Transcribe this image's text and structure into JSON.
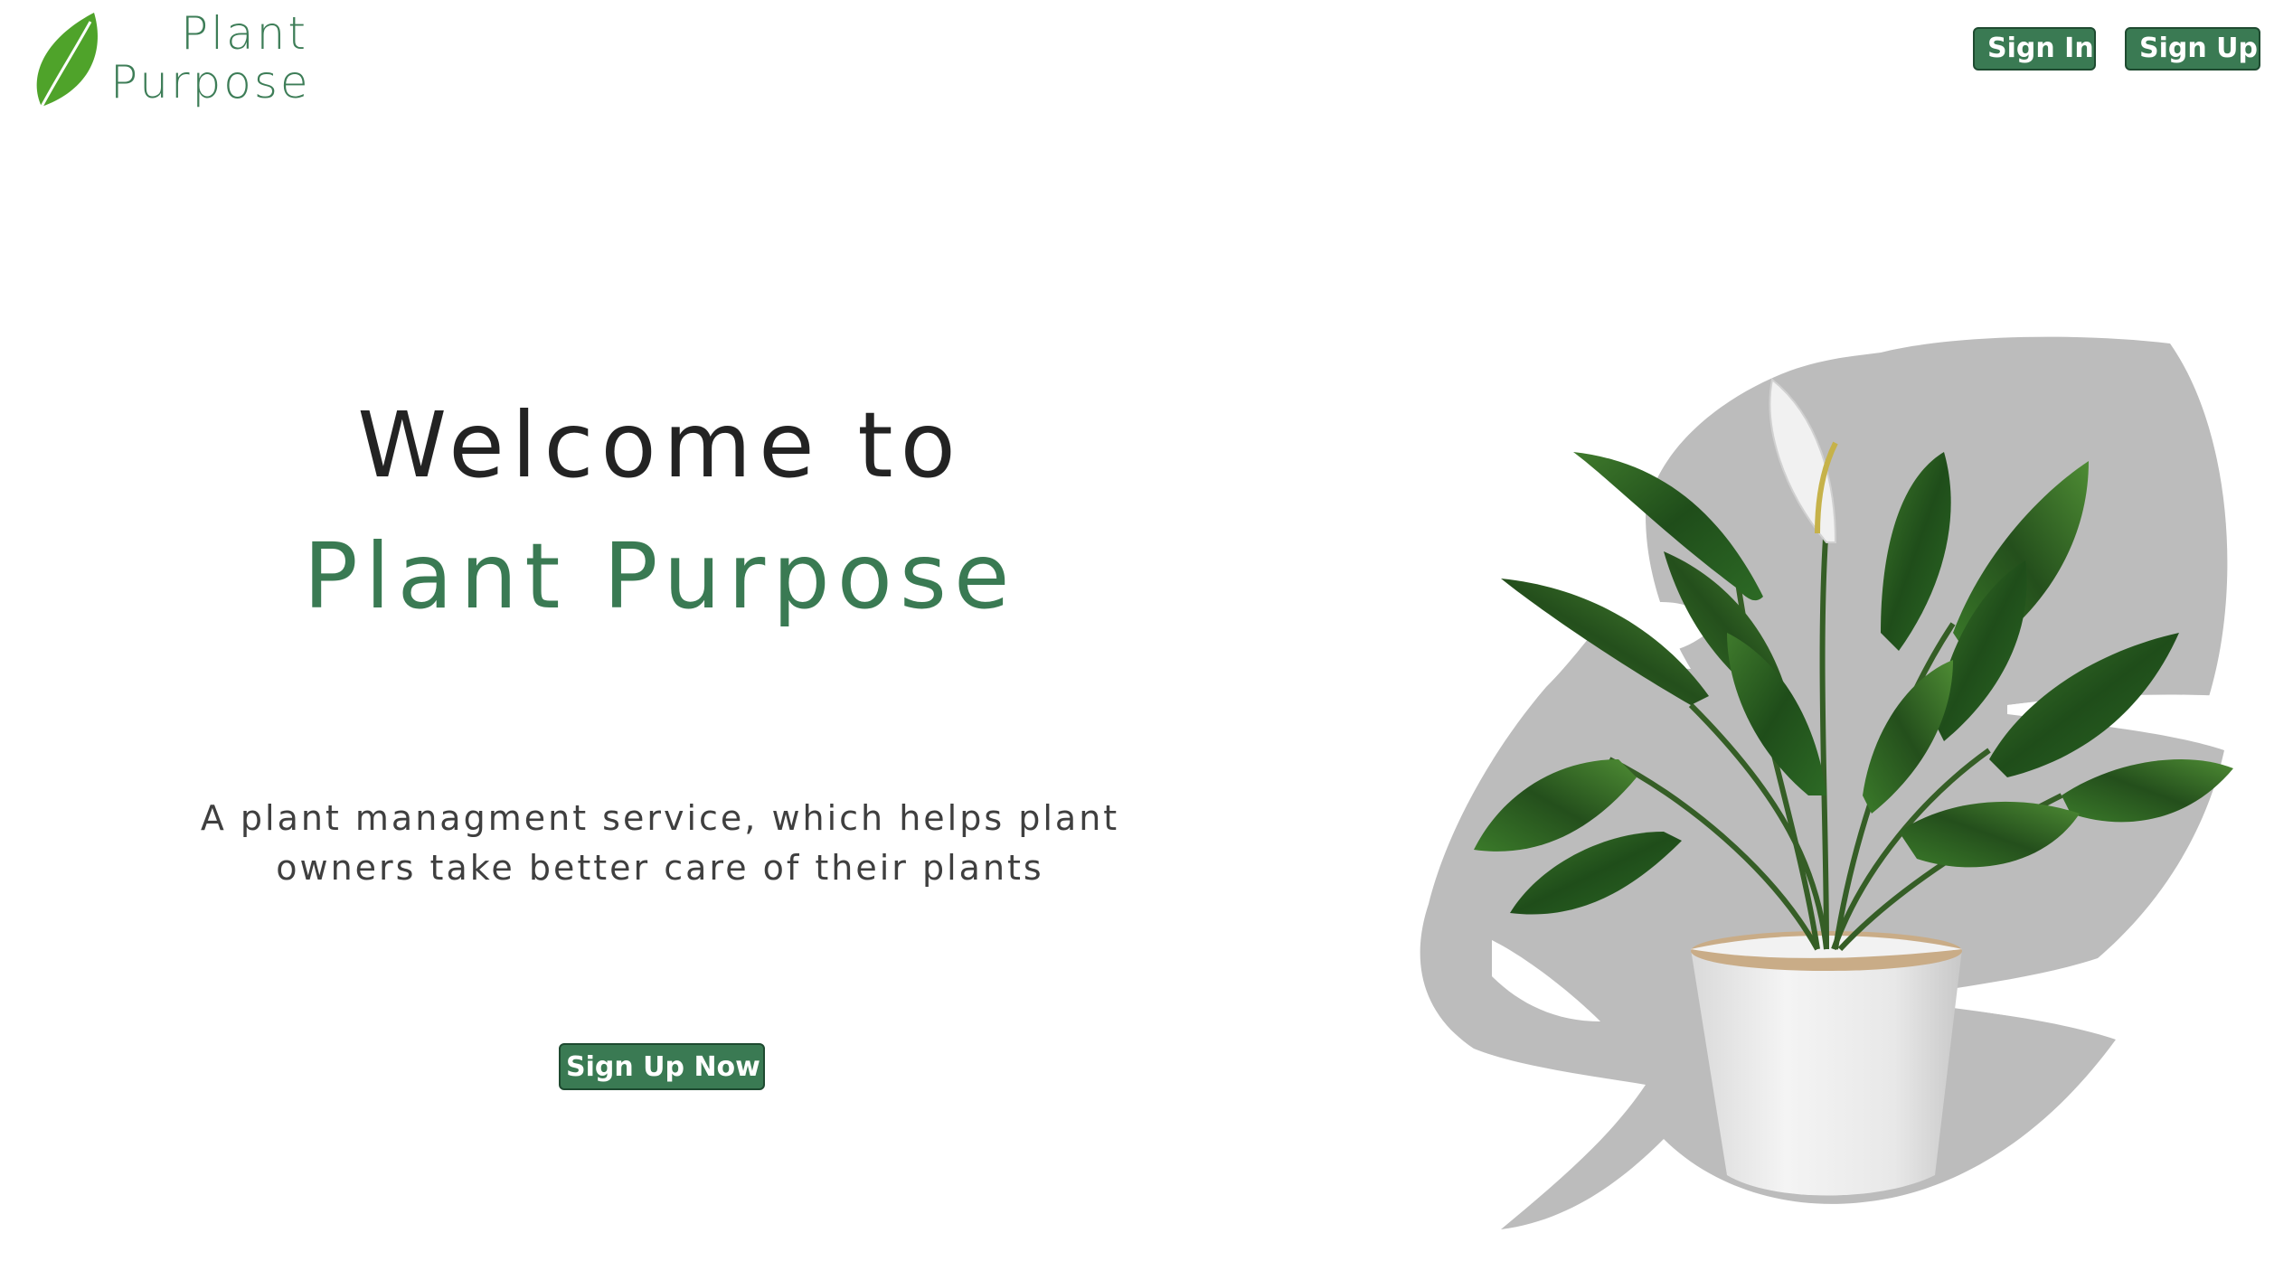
{
  "header": {
    "logo": {
      "line1": "Plant",
      "line2": "Purpose",
      "icon": "leaf-icon"
    },
    "sign_in_label": "Sign In",
    "sign_up_label": "Sign Up"
  },
  "hero": {
    "title_line1": "Welcome to",
    "title_line2": "Plant Purpose",
    "tagline": "A plant managment service, which helps plant owners take better care of their plants",
    "cta_label": "Sign Up Now"
  },
  "illustration": {
    "description_icon": "potted-plant-illustration",
    "background_shape": "monstera-leaf-shape"
  },
  "colors": {
    "brand_green": "#3a7a53",
    "leaf_green": "#4fa32a",
    "heading_dark": "#232323",
    "text_gray": "#3f3f3f",
    "leaf_silhouette": "#bcbcbc"
  }
}
